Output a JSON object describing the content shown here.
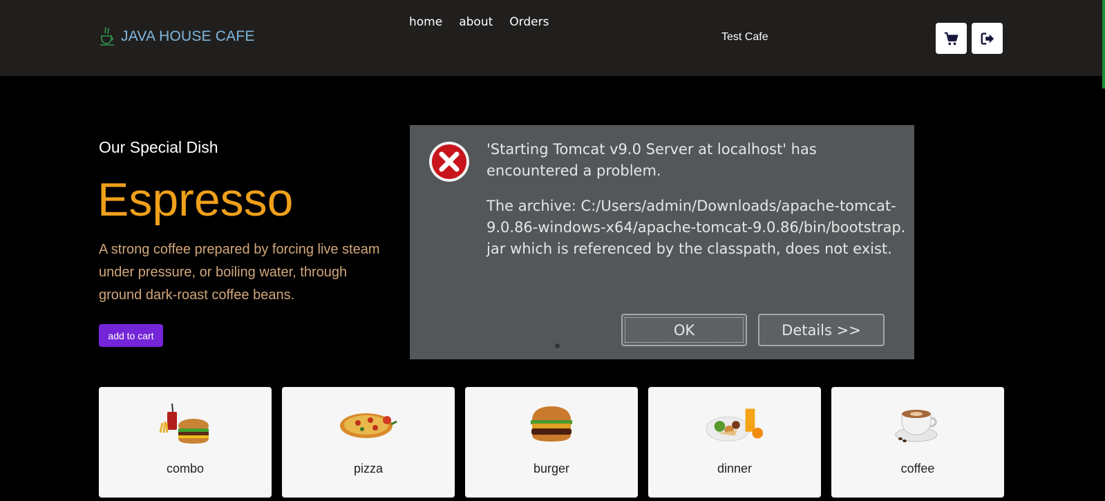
{
  "header": {
    "brand": "JAVA HOUSE CAFE",
    "nav": [
      "home",
      "about",
      "Orders"
    ],
    "username": "Test Cafe",
    "icons": {
      "logo": "java-cup-icon",
      "cart": "cart-icon",
      "logout": "logout-icon"
    }
  },
  "hero": {
    "subtitle": "Our Special Dish",
    "title": "Espresso",
    "description": "A strong coffee prepared by forcing live steam under pressure, or boiling water, through ground dark-roast coffee beans.",
    "button": "add to cart"
  },
  "dialog": {
    "message_line1": "'Starting Tomcat v9.0 Server at localhost' has encountered a problem.",
    "message_line2": "The archive: C:/Users/admin/Downloads/apache-tomcat-9.0.86-windows-x64/apache-tomcat-9.0.86/bin/bootstrap.jar which is referenced by the classpath, does not exist.",
    "ok": "OK",
    "details": "Details >>"
  },
  "categories": [
    {
      "label": "combo",
      "icon": "combo-meal-icon"
    },
    {
      "label": "pizza",
      "icon": "pizza-icon"
    },
    {
      "label": "burger",
      "icon": "burger-icon"
    },
    {
      "label": "dinner",
      "icon": "dinner-plate-icon"
    },
    {
      "label": "coffee",
      "icon": "coffee-cup-icon"
    }
  ],
  "colors": {
    "header_bg": "#211f1d",
    "brand": "#7fb7e0",
    "accent_orange": "#f0a01a",
    "desc_tan": "#d2a77a",
    "button_purple": "#7425d8",
    "dialog_bg": "#535759"
  }
}
